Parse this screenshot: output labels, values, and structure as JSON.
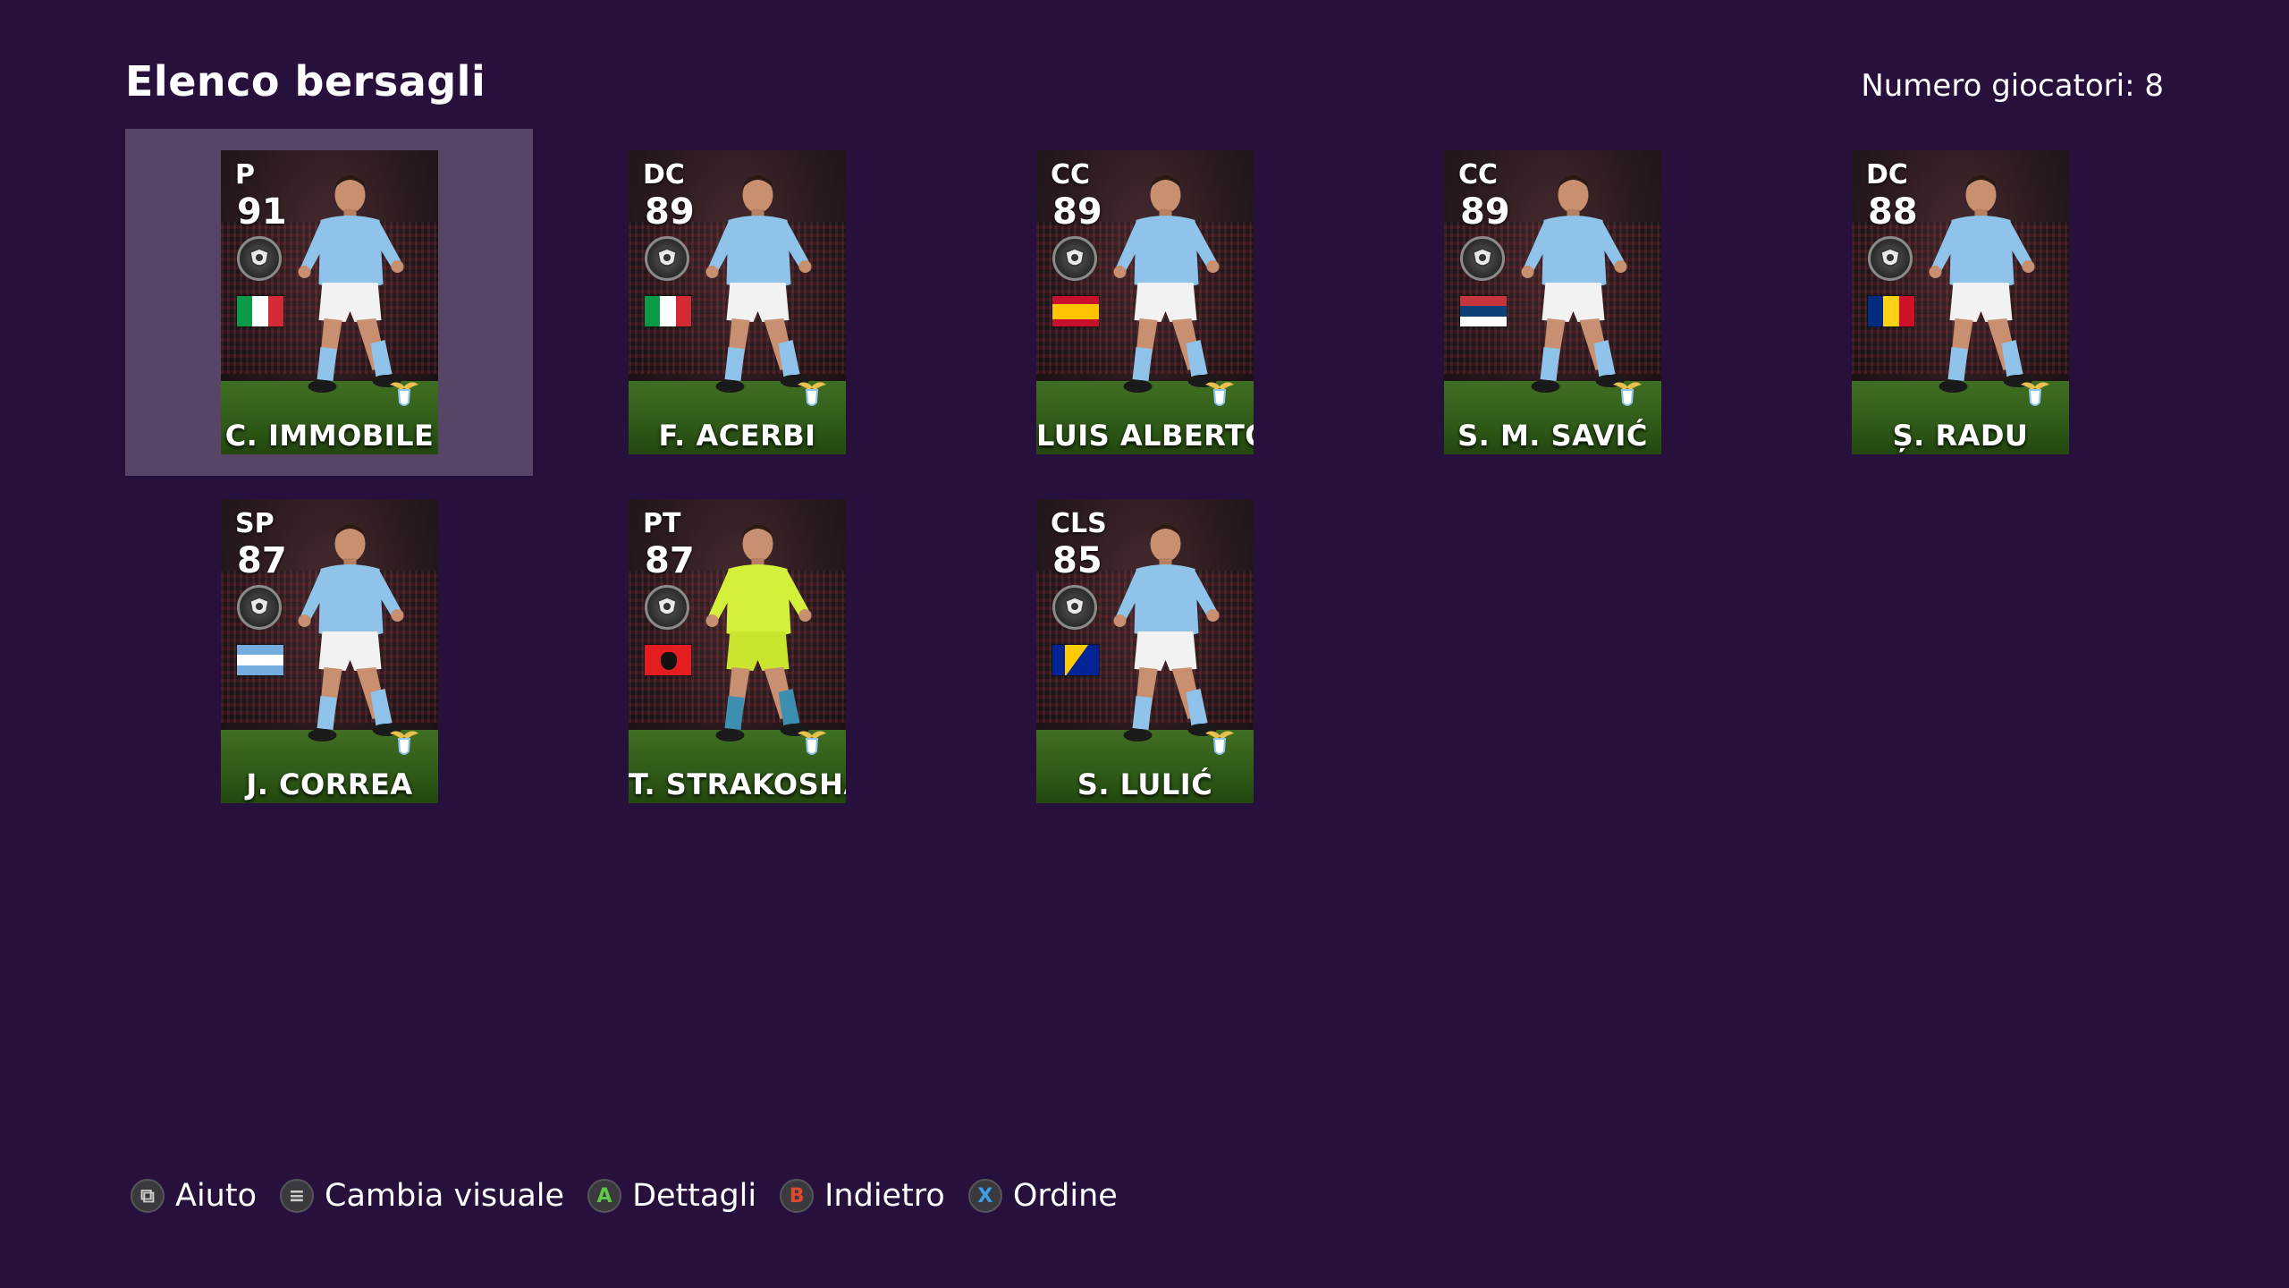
{
  "header": {
    "title": "Elenco bersagli",
    "count_label": "Numero giocatori: 8"
  },
  "selected_index": 0,
  "players": [
    {
      "position": "P",
      "rating": "91",
      "name": "C. IMMOBILE",
      "flag": "italy",
      "kit": "light-blue"
    },
    {
      "position": "DC",
      "rating": "89",
      "name": "F. ACERBI",
      "flag": "italy",
      "kit": "light-blue"
    },
    {
      "position": "CC",
      "rating": "89",
      "name": "LUIS ALBERTO",
      "flag": "spain",
      "kit": "light-blue"
    },
    {
      "position": "CC",
      "rating": "89",
      "name": "S. M. SAVIĆ",
      "flag": "serbia",
      "kit": "light-blue"
    },
    {
      "position": "DC",
      "rating": "88",
      "name": "Ș. RADU",
      "flag": "romania",
      "kit": "light-blue"
    },
    {
      "position": "SP",
      "rating": "87",
      "name": "J. CORREA",
      "flag": "argentina",
      "kit": "light-blue"
    },
    {
      "position": "PT",
      "rating": "87",
      "name": "T. STRAKOSHA",
      "flag": "albania",
      "kit": "goalkeeper-yellow"
    },
    {
      "position": "CLS",
      "rating": "85",
      "name": "S. LULIĆ",
      "flag": "bosnia",
      "kit": "light-blue"
    }
  ],
  "hints": [
    {
      "icon": "view-icon",
      "glyph": "⧉",
      "label": "Aiuto",
      "color": "#cccccc"
    },
    {
      "icon": "menu-icon",
      "glyph": "≡",
      "label": "Cambia visuale",
      "color": "#cccccc"
    },
    {
      "icon": "a-button-icon",
      "glyph": "A",
      "label": "Dettagli",
      "color": "#5fc84a"
    },
    {
      "icon": "b-button-icon",
      "glyph": "B",
      "label": "Indietro",
      "color": "#e0482e"
    },
    {
      "icon": "x-button-icon",
      "glyph": "X",
      "label": "Ordine",
      "color": "#3aa0e8"
    }
  ],
  "colors": {
    "background": "#28103c",
    "kit_light_blue": "#8fc3ea",
    "kit_gk": "#d4f03a"
  }
}
